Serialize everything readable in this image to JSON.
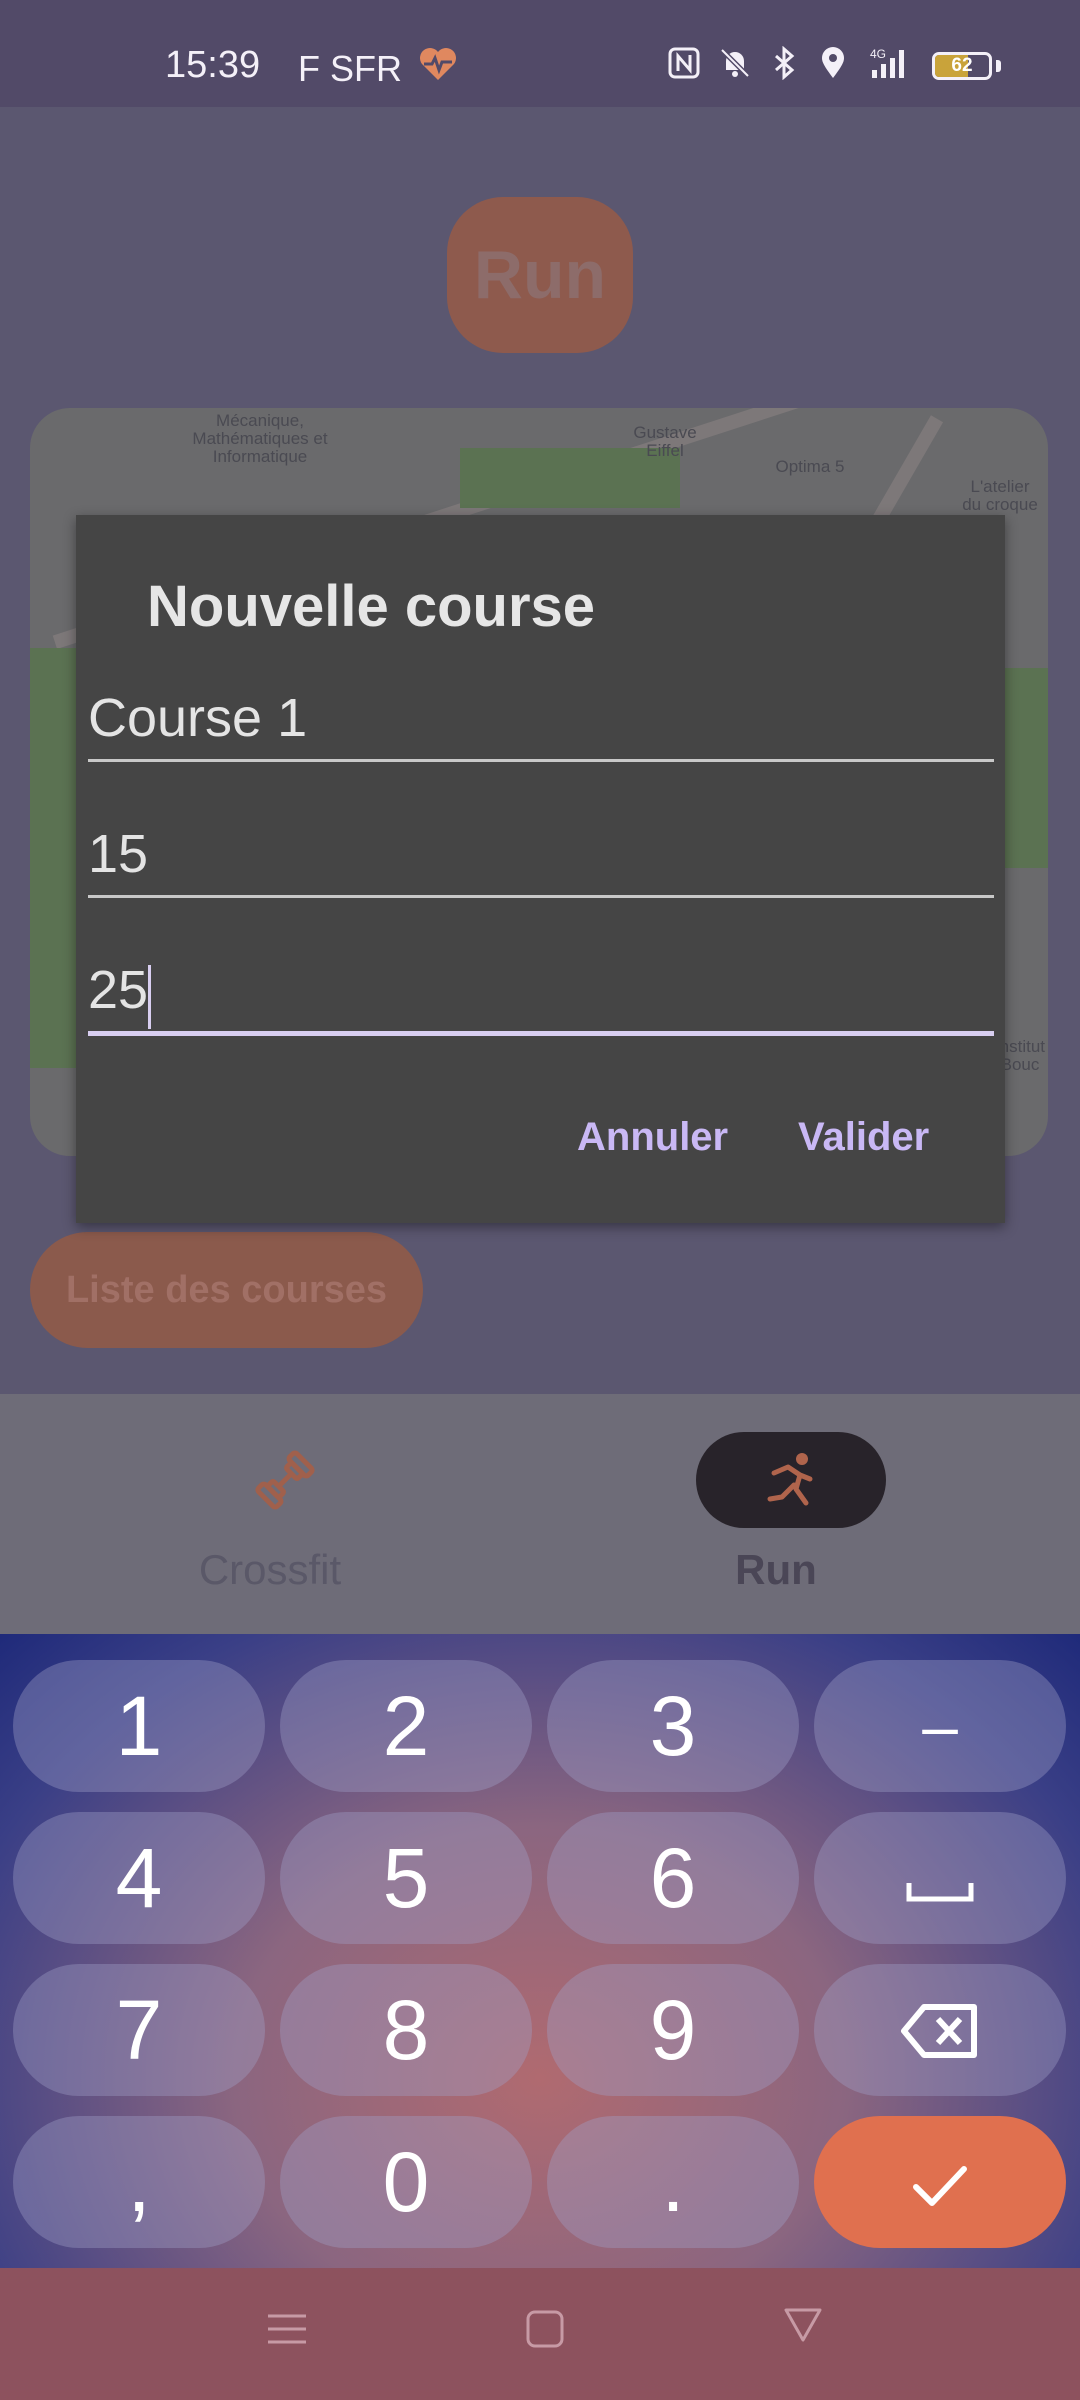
{
  "status_bar": {
    "time": "15:39",
    "carrier": "F SFR",
    "battery_level": "62",
    "icons": [
      "heart-health-icon",
      "nfc-icon",
      "bell-muted-icon",
      "bluetooth-icon",
      "location-icon",
      "signal-4g-icon",
      "battery-icon"
    ]
  },
  "app": {
    "title": "Run",
    "list_button": "Liste des courses",
    "map_labels": {
      "label_a": "Mécanique, Mathématiques et Informatique",
      "label_b": "Gustave Eiffel",
      "label_c": "Optima 5",
      "label_d": "L'atelier du croque",
      "label_e": "Institut Bouc"
    },
    "nav": [
      {
        "label": "Crossfit",
        "icon": "dumbbell-icon",
        "active": false
      },
      {
        "label": "Run",
        "icon": "running-icon",
        "active": true
      }
    ]
  },
  "dialog": {
    "title": "Nouvelle course",
    "fields": [
      {
        "value": "Course 1"
      },
      {
        "value": "15"
      },
      {
        "value": "25",
        "focused": true
      }
    ],
    "cancel_label": "Annuler",
    "confirm_label": "Valider"
  },
  "keyboard": {
    "rows": [
      [
        "1",
        "2",
        "3",
        "–"
      ],
      [
        "4",
        "5",
        "6",
        "space"
      ],
      [
        "7",
        "8",
        "9",
        "backspace"
      ],
      [
        ",",
        "0",
        ".",
        "enter"
      ]
    ]
  },
  "colors": {
    "accent": "#e0704f",
    "dialog_bg": "#454545",
    "dialog_button": "#c9b8f5"
  }
}
